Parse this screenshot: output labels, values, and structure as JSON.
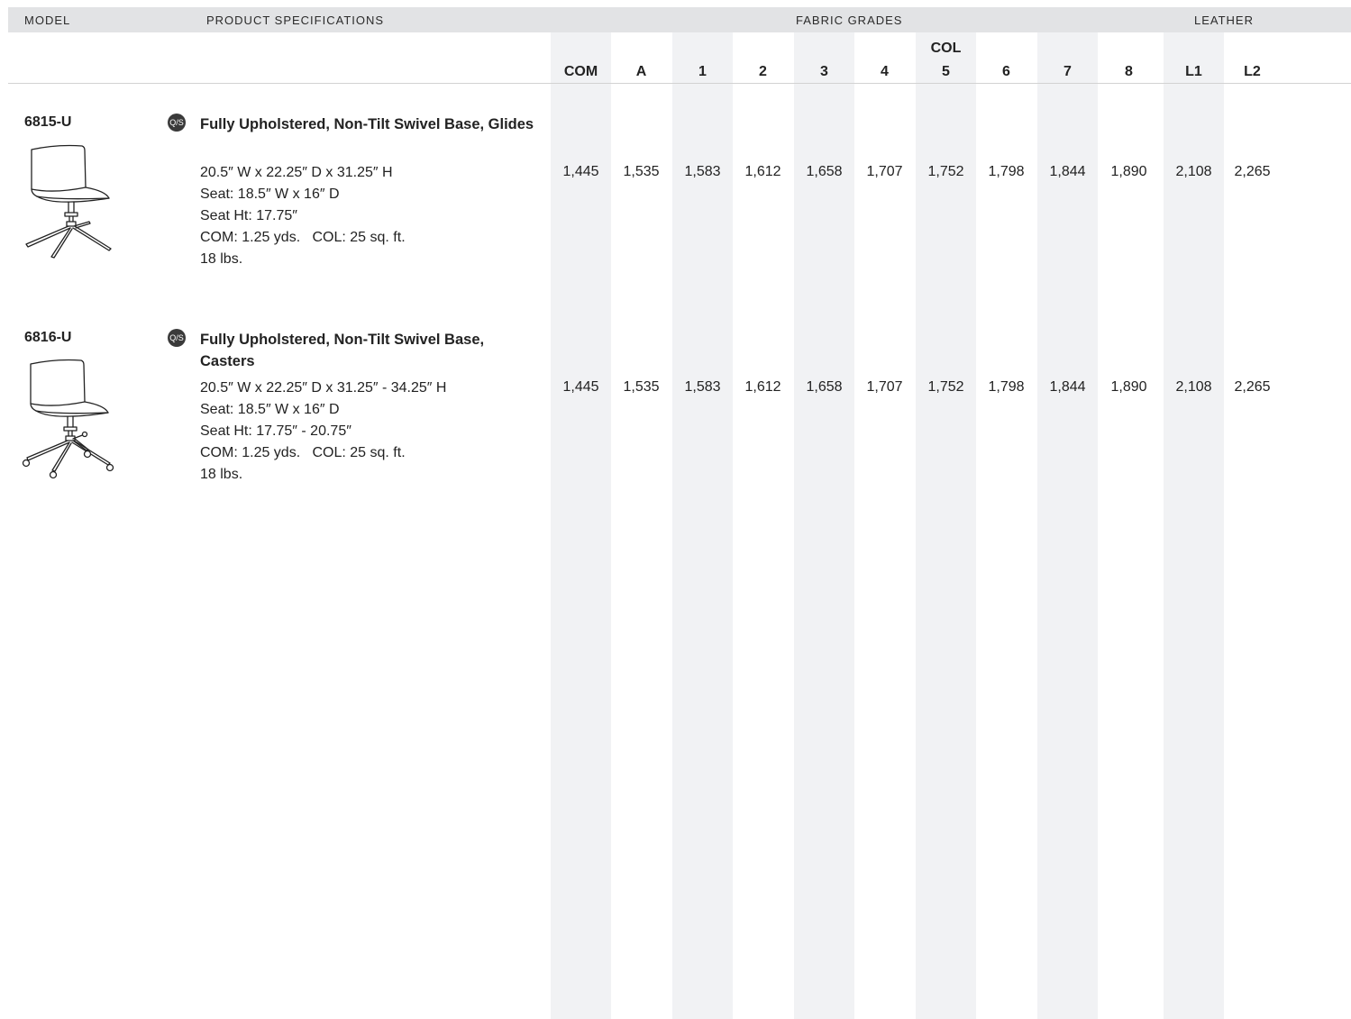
{
  "header": {
    "model": "MODEL",
    "product_specifications": "PRODUCT SPECIFICATIONS",
    "fabric_grades": "FABRIC GRADES",
    "leather": "LEATHER"
  },
  "columns": [
    {
      "top": "",
      "label": "COM"
    },
    {
      "top": "",
      "label": "A"
    },
    {
      "top": "",
      "label": "1"
    },
    {
      "top": "",
      "label": "2"
    },
    {
      "top": "",
      "label": "3"
    },
    {
      "top": "",
      "label": "4"
    },
    {
      "top": "COL",
      "label": "5"
    },
    {
      "top": "",
      "label": "6"
    },
    {
      "top": "",
      "label": "7"
    },
    {
      "top": "",
      "label": "8"
    },
    {
      "top": "",
      "label": "L1"
    },
    {
      "top": "",
      "label": "L2"
    }
  ],
  "products": [
    {
      "model": "6815-U",
      "badge": "Q/S",
      "icon": "chair-glides-icon",
      "title": "Fully Upholstered, Non-Tilt Swivel Base, Glides",
      "specs": [
        "20.5″ W x 22.25″ D x 31.25″ H",
        "Seat: 18.5″ W x 16″ D",
        "Seat Ht: 17.75″",
        "COM: 1.25 yds.   COL: 25 sq. ft.",
        "18 lbs."
      ],
      "prices": [
        "1,445",
        "1,535",
        "1,583",
        "1,612",
        "1,658",
        "1,707",
        "1,752",
        "1,798",
        "1,844",
        "1,890",
        "2,108",
        "2,265"
      ]
    },
    {
      "model": "6816-U",
      "badge": "Q/S",
      "icon": "chair-casters-icon",
      "title": "Fully Upholstered, Non-Tilt Swivel Base, Casters",
      "specs": [
        "20.5″ W x 22.25″ D x 31.25″ - 34.25″ H",
        "Seat: 18.5″ W x 16″ D",
        "Seat Ht: 17.75″ - 20.75″",
        "COM: 1.25 yds.   COL: 25 sq. ft.",
        "18 lbs."
      ],
      "prices": [
        "1,445",
        "1,535",
        "1,583",
        "1,612",
        "1,658",
        "1,707",
        "1,752",
        "1,798",
        "1,844",
        "1,890",
        "2,108",
        "2,265"
      ]
    }
  ]
}
